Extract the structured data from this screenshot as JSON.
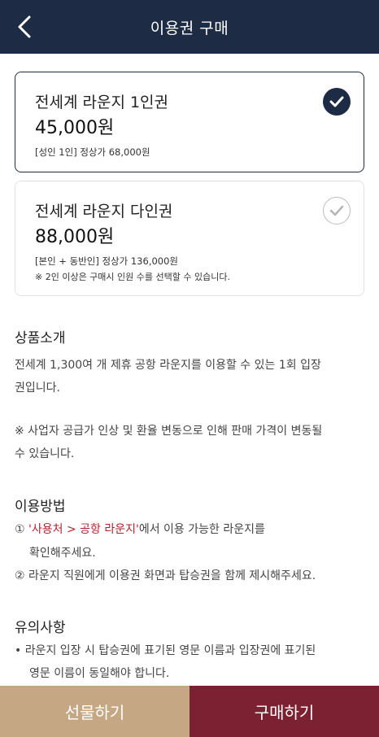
{
  "header": {
    "title": "이용권 구매",
    "back_icon": "chevron-left-icon"
  },
  "tickets": [
    {
      "name": "전세계 라운지 1인권",
      "price": "45,000원",
      "note1": "[성인 1인] 정상가 68,000원",
      "note2": "",
      "selected": true
    },
    {
      "name": "전세계 라운지 다인권",
      "price": "88,000원",
      "note1": "[본인 + 동반인] 정상가 136,000원",
      "note2": "※ 2인 이상은 구매시 인원 수를 선택할 수 있습니다.",
      "selected": false
    }
  ],
  "intro": {
    "title": "상품소개",
    "body1_line1": "전세계 1,300여 개 제휴 공항 라운지를 이용할 수 있는 1회 입장",
    "body1_line2": "권입니다.",
    "body2_line1": "※ 사업자 공급가 인상 및 환율 변동으로 인해 판매 가격이 변동될",
    "body2_line2": "수 있습니다."
  },
  "usage": {
    "title": "이용방법",
    "step1_prefix": "① ",
    "step1_highlight": "'사용처 > 공항 라운지'",
    "step1_suffix": "에서 이용 가능한 라운지를",
    "step1_cont": "확인해주세요.",
    "step2": "② 라운지 직원에게 이용권 화면과 탑승권을 함께 제시해주세요."
  },
  "notice": {
    "title": "유의사항",
    "line1": "• 라운지 입장 시 탑승권에 표기된 영문 이름과 입장권에 표기된",
    "line2": "영문 이름이 동일해야 합니다."
  },
  "footer": {
    "gift_label": "선물하기",
    "buy_label": "구매하기"
  },
  "colors": {
    "navy": "#1d2b45",
    "gold": "#c5a883",
    "burgundy": "#7c2132",
    "highlight": "#b3232f"
  }
}
